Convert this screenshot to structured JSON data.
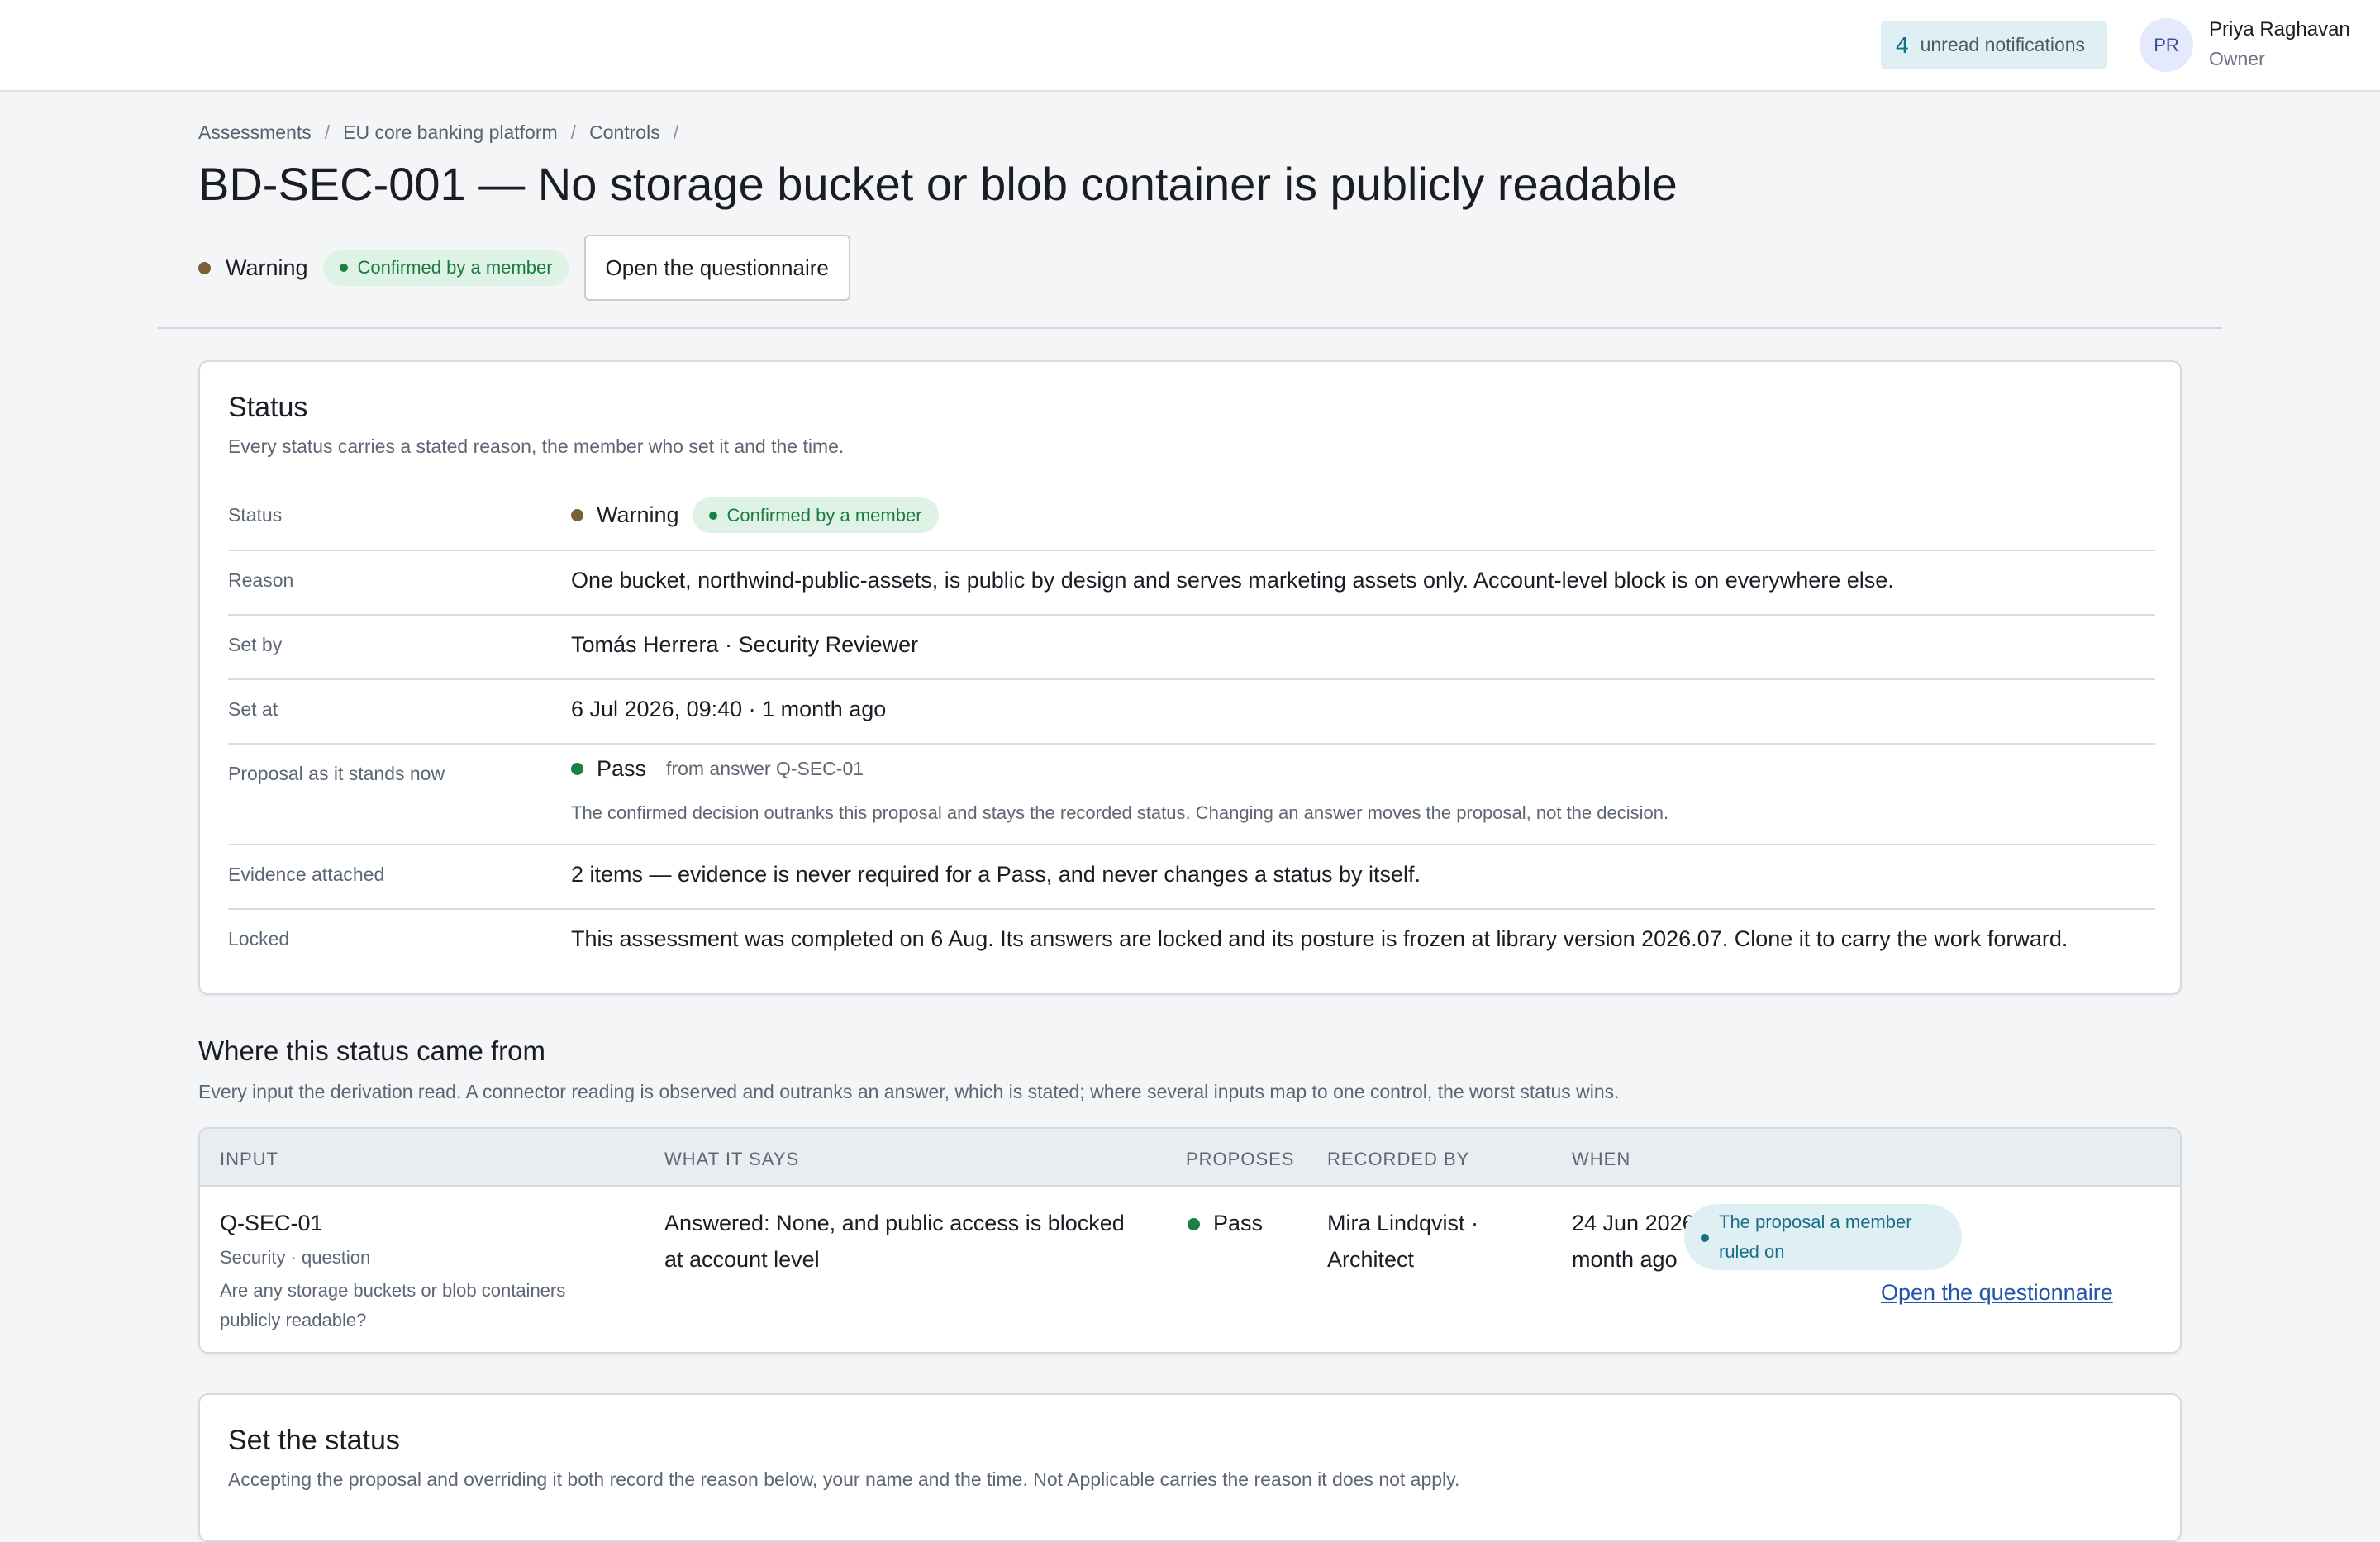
{
  "header": {
    "notifications": {
      "count": "4",
      "label": "unread notifications"
    },
    "user": {
      "initials": "PR",
      "name": "Priya Raghavan",
      "role": "Owner"
    }
  },
  "breadcrumb": [
    "Assessments",
    "EU core banking platform",
    "Controls"
  ],
  "breadcrumb_sep": "/",
  "page": {
    "title": "BD-SEC-001 — No storage bucket or blob container is publicly readable",
    "status": "Warning",
    "confirmed_label": "Confirmed by a member",
    "questionnaire_button": "Open the questionnaire"
  },
  "status_card": {
    "title": "Status",
    "subtitle": "Every status carries a stated reason, the member who set it and the time.",
    "rows": {
      "status": {
        "label": "Status",
        "value": "Warning",
        "badge": "Confirmed by a member"
      },
      "reason": {
        "label": "Reason",
        "value": "One bucket, northwind-public-assets, is public by design and serves marketing assets only. Account-level block is on everywhere else."
      },
      "set_by": {
        "label": "Set by",
        "value": "Tomás Herrera · Security Reviewer"
      },
      "set_at": {
        "label": "Set at",
        "value": "6 Jul 2026, 09:40 · 1 month ago"
      },
      "proposal": {
        "label": "Proposal as it stands now",
        "value": "Pass",
        "source": "from answer Q-SEC-01",
        "note": "The confirmed decision outranks this proposal and stays the recorded status. Changing an answer moves the proposal, not the decision."
      },
      "evidence": {
        "label": "Evidence attached",
        "value": "2 items — evidence is never required for a Pass, and never changes a status by itself."
      },
      "locked": {
        "label": "Locked",
        "value": "This assessment was completed on 6 Aug. Its answers are locked and its posture is frozen at library version 2026.07. Clone it to carry the work forward."
      }
    }
  },
  "derivation": {
    "title": "Where this status came from",
    "subtitle": "Every input the derivation read. A connector reading is observed and outranks an answer, which is stated; where several inputs map to one control, the worst status wins.",
    "columns": [
      "INPUT",
      "WHAT IT SAYS",
      "PROPOSES",
      "RECORDED BY",
      "WHEN"
    ],
    "rows": [
      {
        "input_id": "Q-SEC-01",
        "input_type": "Security · question",
        "question_line1": "Are any storage buckets or blob containers",
        "question_line2": "publicly readable?",
        "says_line1": "Answered: None, and public access is blocked",
        "says_line2": "at account level",
        "proposes": "Pass",
        "recorded_line1": "Mira Lindqvist ·",
        "recorded_line2": "Architect",
        "when_line1": "24 Jun 2026, 09:40 · 1",
        "when_line2": "month ago",
        "ruled_line1": "The proposal a member",
        "ruled_line2": "ruled on",
        "link": "Open the questionnaire"
      }
    ]
  },
  "set_status": {
    "title": "Set the status",
    "subtitle": "Accepting the proposal and overriding it both record the reason below, your name and the time. Not Applicable carries the reason it does not apply."
  }
}
